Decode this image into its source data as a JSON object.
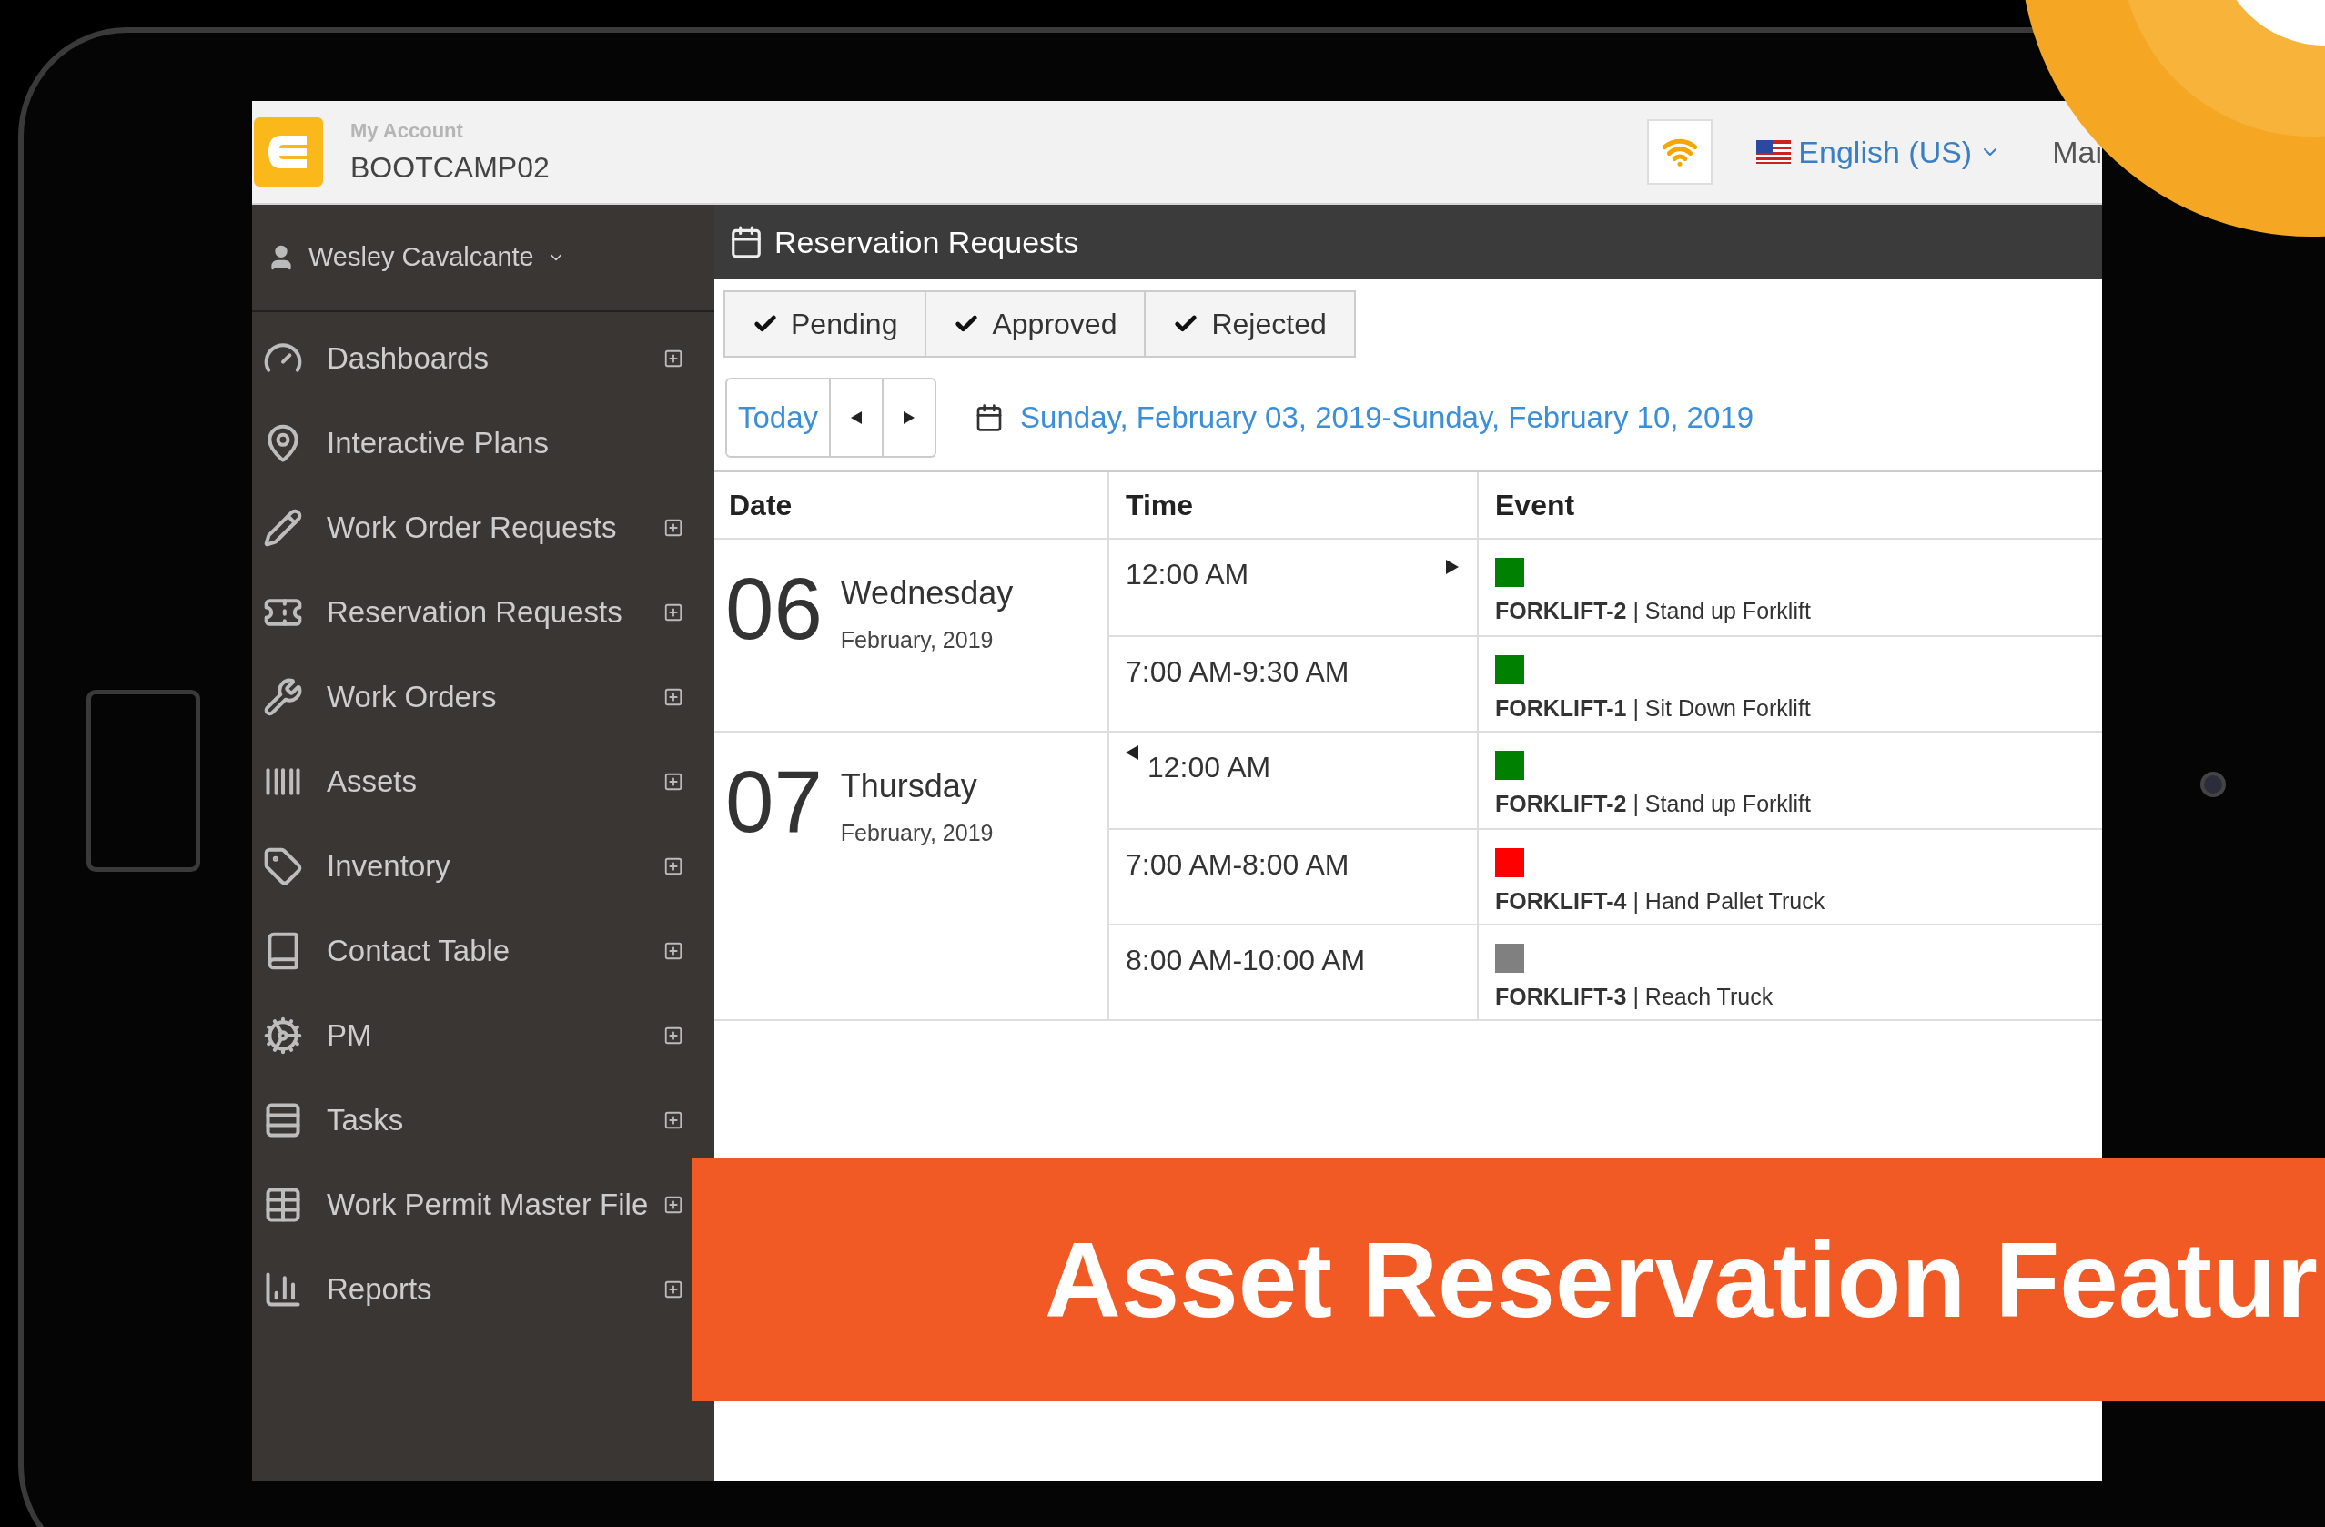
{
  "header": {
    "account_label": "My Account",
    "account": "BOOTCAMP02",
    "language": "English (US)",
    "menu_item": "Mai"
  },
  "sidebar": {
    "user": "Wesley Cavalcante",
    "items": [
      {
        "label": "Dashboards",
        "expandable": true
      },
      {
        "label": "Interactive Plans",
        "expandable": false
      },
      {
        "label": "Work Order Requests",
        "expandable": true
      },
      {
        "label": "Reservation Requests",
        "expandable": true
      },
      {
        "label": "Work Orders",
        "expandable": true
      },
      {
        "label": "Assets",
        "expandable": true
      },
      {
        "label": "Inventory",
        "expandable": true
      },
      {
        "label": "Contact Table",
        "expandable": true
      },
      {
        "label": "PM",
        "expandable": true
      },
      {
        "label": "Tasks",
        "expandable": true
      },
      {
        "label": "Work Permit Master File",
        "expandable": true
      },
      {
        "label": "Reports",
        "expandable": true
      }
    ]
  },
  "page": {
    "title": "Reservation Requests",
    "filters": [
      {
        "label": "Pending",
        "checked": true
      },
      {
        "label": "Approved",
        "checked": true
      },
      {
        "label": "Rejected",
        "checked": true
      }
    ],
    "today_button": "Today",
    "date_range": "Sunday, February 03, 2019-Sunday, February 10, 2019"
  },
  "table": {
    "columns": [
      "Date",
      "Time",
      "Event"
    ],
    "days": [
      {
        "day": "06",
        "weekday": "Wednesday",
        "month": "February, 2019",
        "entries": [
          {
            "time": "12:00 AM",
            "continues_before": false,
            "continues_after": true,
            "event": "**FORKLIFT-2** | Stand up Forklift",
            "color": "#008000"
          },
          {
            "time": "7:00 AM-9:30 AM",
            "continues_before": false,
            "continues_after": false,
            "event": "**FORKLIFT-1** | Sit Down Forklift",
            "color": "#008000"
          }
        ]
      },
      {
        "day": "07",
        "weekday": "Thursday",
        "month": "February, 2019",
        "entries": [
          {
            "time": "12:00 AM",
            "continues_before": true,
            "continues_after": false,
            "event": "**FORKLIFT-2** | Stand up Forklift",
            "color": "#008000"
          },
          {
            "time": "7:00 AM-8:00 AM",
            "continues_before": false,
            "continues_after": false,
            "event": "**FORKLIFT-4** | Hand Pallet Truck",
            "color": "#ff0000"
          },
          {
            "time": "8:00 AM-10:00 AM",
            "continues_before": false,
            "continues_after": false,
            "event": "**FORKLIFT-3** | Reach Truck",
            "color": "#808080"
          }
        ]
      }
    ]
  },
  "banner": {
    "text": "Asset Reservation Featur"
  }
}
